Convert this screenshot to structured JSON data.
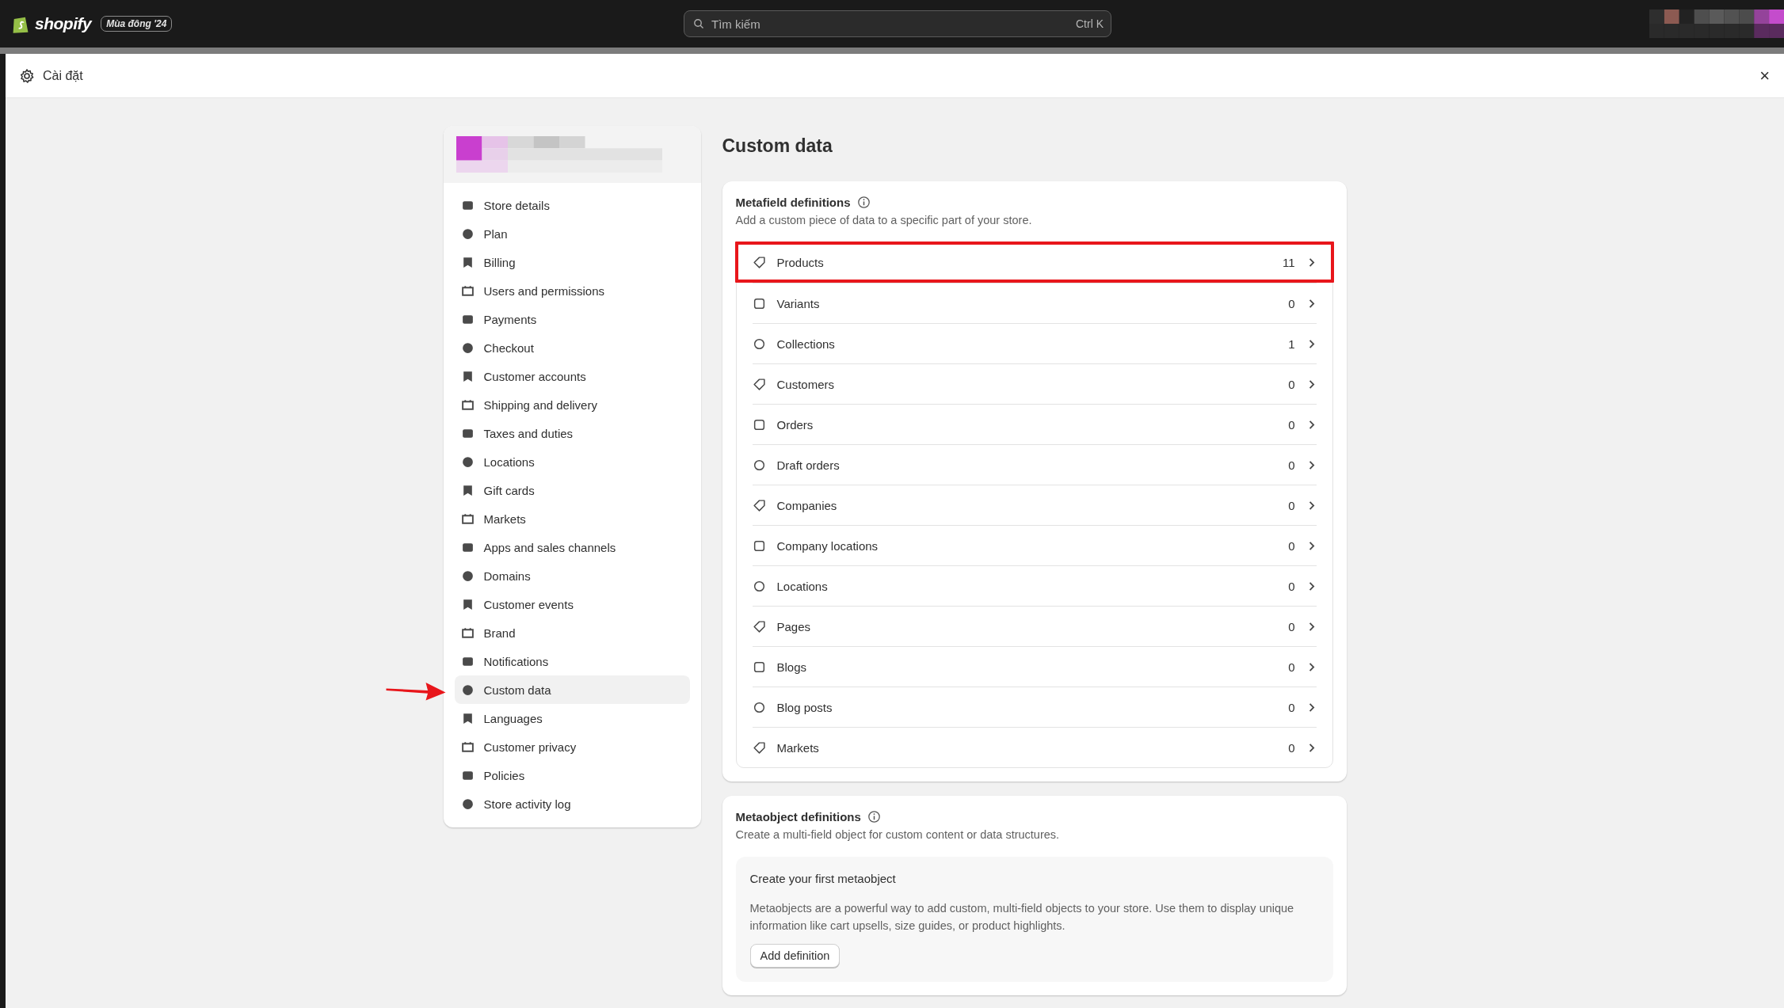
{
  "topbar": {
    "brand": "shopify",
    "edition_badge": "Mùa đông '24",
    "search": {
      "placeholder": "Tìm kiếm",
      "shortcut": "Ctrl K"
    }
  },
  "modal": {
    "title": "Cài đặt",
    "close": "×"
  },
  "sidebar": {
    "items": [
      {
        "label": "Store details",
        "selected": false
      },
      {
        "label": "Plan",
        "selected": false
      },
      {
        "label": "Billing",
        "selected": false
      },
      {
        "label": "Users and permissions",
        "selected": false
      },
      {
        "label": "Payments",
        "selected": false
      },
      {
        "label": "Checkout",
        "selected": false
      },
      {
        "label": "Customer accounts",
        "selected": false
      },
      {
        "label": "Shipping and delivery",
        "selected": false
      },
      {
        "label": "Taxes and duties",
        "selected": false
      },
      {
        "label": "Locations",
        "selected": false
      },
      {
        "label": "Gift cards",
        "selected": false
      },
      {
        "label": "Markets",
        "selected": false
      },
      {
        "label": "Apps and sales channels",
        "selected": false
      },
      {
        "label": "Domains",
        "selected": false
      },
      {
        "label": "Customer events",
        "selected": false
      },
      {
        "label": "Brand",
        "selected": false
      },
      {
        "label": "Notifications",
        "selected": false
      },
      {
        "label": "Custom data",
        "selected": true,
        "annotated": true
      },
      {
        "label": "Languages",
        "selected": false
      },
      {
        "label": "Customer privacy",
        "selected": false
      },
      {
        "label": "Policies",
        "selected": false
      },
      {
        "label": "Store activity log",
        "selected": false
      }
    ]
  },
  "page_title": "Custom data",
  "metafields": {
    "title": "Metafield definitions",
    "description": "Add a custom piece of data to a specific part of your store.",
    "rows": [
      {
        "label": "Products",
        "count": "11",
        "highlighted": true
      },
      {
        "label": "Variants",
        "count": "0",
        "highlighted": false
      },
      {
        "label": "Collections",
        "count": "1",
        "highlighted": false
      },
      {
        "label": "Customers",
        "count": "0",
        "highlighted": false
      },
      {
        "label": "Orders",
        "count": "0",
        "highlighted": false
      },
      {
        "label": "Draft orders",
        "count": "0",
        "highlighted": false
      },
      {
        "label": "Companies",
        "count": "0",
        "highlighted": false
      },
      {
        "label": "Company locations",
        "count": "0",
        "highlighted": false
      },
      {
        "label": "Locations",
        "count": "0",
        "highlighted": false
      },
      {
        "label": "Pages",
        "count": "0",
        "highlighted": false
      },
      {
        "label": "Blogs",
        "count": "0",
        "highlighted": false
      },
      {
        "label": "Blog posts",
        "count": "0",
        "highlighted": false
      },
      {
        "label": "Markets",
        "count": "0",
        "highlighted": false
      }
    ]
  },
  "metaobjects": {
    "title": "Metaobject definitions",
    "description": "Create a multi-field object for custom content or data structures.",
    "empty_state": {
      "title": "Create your first metaobject",
      "body": "Metaobjects are a powerful way to add custom, multi-field objects to your store. Use them to display unique information like cart upsells, size guides, or product highlights.",
      "button": "Add definition"
    }
  }
}
